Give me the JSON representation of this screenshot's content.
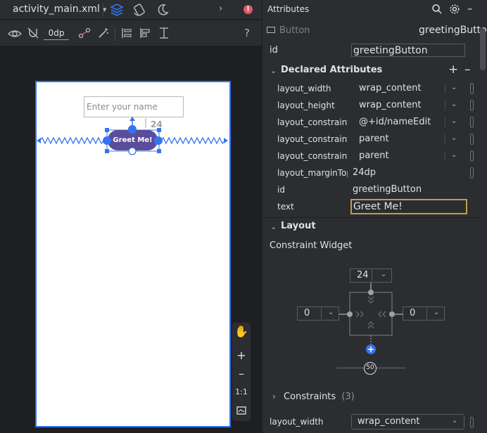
{
  "editor": {
    "file_tab": "activity_main.xml",
    "default_margin": "0dp",
    "help": "?",
    "zoom_ratio": "1:1"
  },
  "preview": {
    "name_placeholder": "Enter your name",
    "button_text": "Greet Me!",
    "margin_top_label": "24"
  },
  "attributes": {
    "panel_title": "Attributes",
    "widget_type": "Button",
    "widget_id": "greetingButton",
    "id_label": "id",
    "id_value": "greetingButton",
    "declared_header": "Declared Attributes",
    "declared": [
      {
        "name": "layout_width",
        "value": "wrap_content",
        "dropdown": true
      },
      {
        "name": "layout_height",
        "value": "wrap_content",
        "dropdown": true
      },
      {
        "name": "layout_constraint...",
        "value": "@+id/nameEdit",
        "dropdown": true
      },
      {
        "name": "layout_constraint...",
        "value": "parent",
        "dropdown": true
      },
      {
        "name": "layout_constraint...",
        "value": "parent",
        "dropdown": true
      },
      {
        "name": "layout_marginTop",
        "value": "24dp",
        "dropdown": false
      },
      {
        "name": "id",
        "value": "greetingButton",
        "dropdown": false
      },
      {
        "name": "text",
        "value": "Greet Me!",
        "dropdown": false
      }
    ],
    "layout_header": "Layout",
    "constraint_widget_label": "Constraint Widget",
    "cw_top": "24",
    "cw_left": "0",
    "cw_right": "0",
    "cw_bias": "50",
    "constraints_label": "Constraints",
    "constraints_count": "(3)",
    "bottom_attr_name": "layout_width",
    "bottom_attr_value": "wrap_content"
  },
  "colors": {
    "accent": "#3574f0",
    "button_purple": "#5a4d9a",
    "error_red": "#e55765",
    "field_focus": "#c29c4a"
  }
}
